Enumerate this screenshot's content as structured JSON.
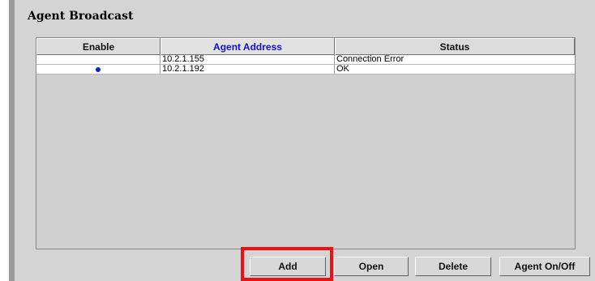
{
  "panel": {
    "title": "Agent Broadcast"
  },
  "table": {
    "columns": [
      "Enable",
      "Agent Address",
      "Status"
    ],
    "rows": [
      {
        "enabled": false,
        "address": "10.2.1.155",
        "status": "Connection Error"
      },
      {
        "enabled": true,
        "address": "10.2.1.192",
        "status": "OK"
      }
    ]
  },
  "buttons": {
    "add": "Add",
    "open": "Open",
    "delete": "Delete",
    "agent_toggle": "Agent On/Off"
  },
  "colors": {
    "active_header": "#1010d0",
    "enabled_dot": "#1020c8",
    "highlight_box": "#ee1111"
  },
  "icons": {
    "enabled_marker": "enabled-dot-icon"
  }
}
